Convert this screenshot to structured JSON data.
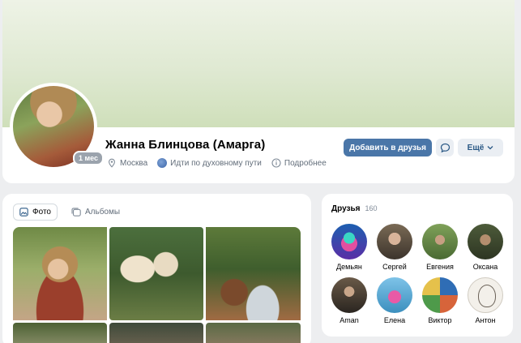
{
  "profile": {
    "name": "Жанна Блинцова (Амарга)",
    "online_badge": "1 мес",
    "info": {
      "city": "Москва",
      "status": "Идти по духовному пути",
      "details": "Подробнее"
    },
    "buttons": {
      "add_friend": "Добавить в друзья",
      "more": "Ещё"
    },
    "colors": {
      "primary": "#4a76a8",
      "secondary_bg": "#eaeef3",
      "page_bg": "#edeef0"
    }
  },
  "photos": {
    "tabs": [
      {
        "label": "Фото",
        "icon": "image-icon",
        "active": true
      },
      {
        "label": "Альбомы",
        "icon": "albums-icon",
        "active": false
      }
    ]
  },
  "friends": {
    "title": "Друзья",
    "count": "160",
    "items": [
      {
        "name": "Демьян"
      },
      {
        "name": "Сергей"
      },
      {
        "name": "Евгения"
      },
      {
        "name": "Оксана"
      },
      {
        "name": "Aman"
      },
      {
        "name": "Елена"
      },
      {
        "name": "Виктор"
      },
      {
        "name": "Антон"
      }
    ]
  }
}
